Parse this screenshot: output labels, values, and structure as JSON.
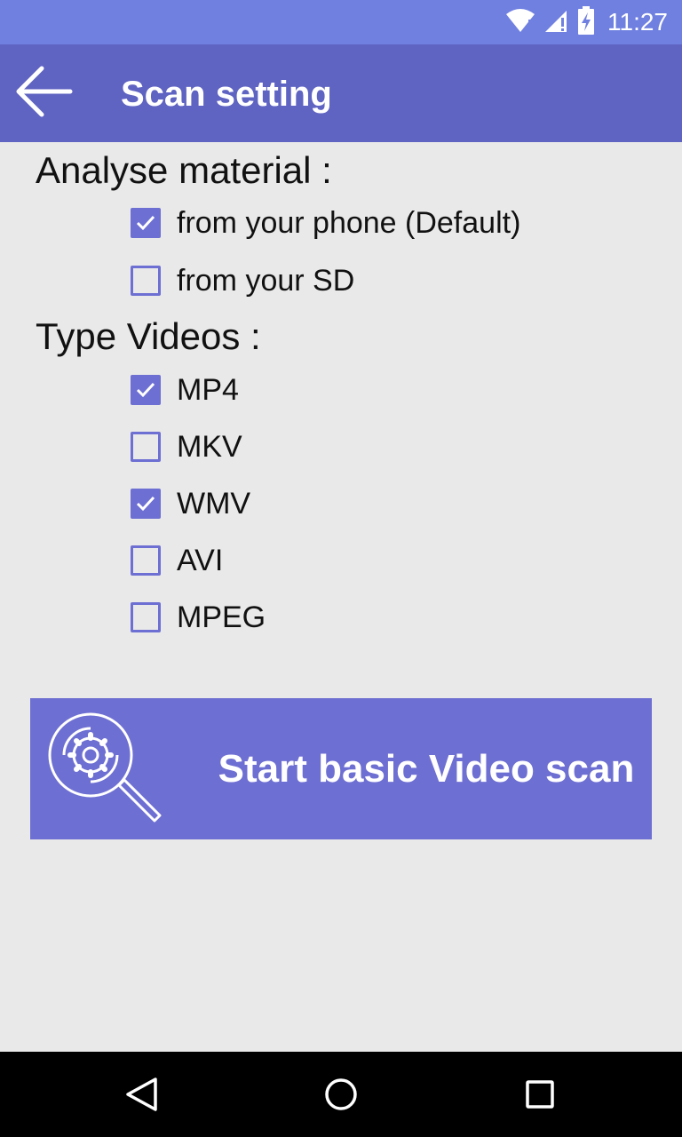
{
  "status_bar": {
    "time": "11:27",
    "icons": [
      "wifi-icon",
      "signal-icon",
      "battery-charging-icon"
    ]
  },
  "app_bar": {
    "title": "Scan setting",
    "back_icon": "arrow-left-icon"
  },
  "sections": {
    "material": {
      "title": "Analyse material :",
      "options": [
        {
          "label": "from your phone (Default)",
          "checked": true
        },
        {
          "label": "from your SD",
          "checked": false
        }
      ]
    },
    "types": {
      "title": "Type Videos :",
      "options": [
        {
          "label": "MP4",
          "checked": true
        },
        {
          "label": "MKV",
          "checked": false
        },
        {
          "label": "WMV",
          "checked": true
        },
        {
          "label": "AVI",
          "checked": false
        },
        {
          "label": "MPEG",
          "checked": false
        }
      ]
    }
  },
  "scan_button": {
    "label": "Start basic Video scan",
    "icon": "magnifier-gear-icon"
  },
  "nav_bar": {
    "icons": [
      "back-triangle-icon",
      "home-circle-icon",
      "recents-square-icon"
    ]
  },
  "colors": {
    "status_bar": "#7080e0",
    "app_bar": "#5f63c2",
    "accent": "#6d6fd2",
    "background": "#e9e9e9"
  }
}
